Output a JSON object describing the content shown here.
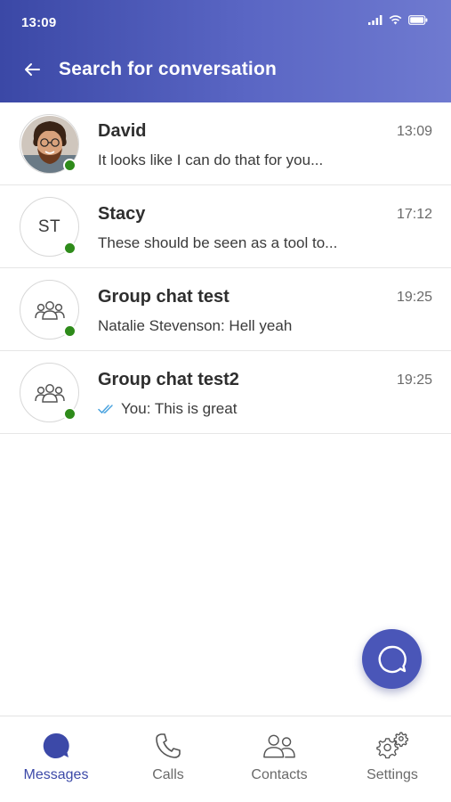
{
  "status_bar": {
    "time": "13:09"
  },
  "header": {
    "title": "Search for conversation"
  },
  "conversations": [
    {
      "name": "David",
      "time": "13:09",
      "preview": "It looks like I can do that for you...",
      "avatar": "photo",
      "online": true
    },
    {
      "name": "Stacy",
      "time": "17:12",
      "preview": "These should be seen as a tool to...",
      "avatar_initials": "ST",
      "online": true
    },
    {
      "name": "Group chat test",
      "time": "19:25",
      "preview": "Natalie Stevenson: Hell yeah",
      "avatar": "group-icon",
      "online": true
    },
    {
      "name": "Group chat test2",
      "time": "19:25",
      "preview": "You: This is great",
      "avatar": "group-icon",
      "read_receipt": "double-check-icon",
      "online": true
    }
  ],
  "fab": {
    "icon": "chat-bubble-icon"
  },
  "bottom_nav": [
    {
      "label": "Messages",
      "icon": "messages-icon",
      "active": true
    },
    {
      "label": "Calls",
      "icon": "phone-icon",
      "active": false
    },
    {
      "label": "Contacts",
      "icon": "contacts-icon",
      "active": false
    },
    {
      "label": "Settings",
      "icon": "settings-icon",
      "active": false
    }
  ],
  "colors": {
    "header_start": "#3b48a6",
    "header_end": "#6f7ad0",
    "accent": "#4a56b8",
    "online": "#2e8b1a",
    "read_receipt": "#4aa3df"
  }
}
